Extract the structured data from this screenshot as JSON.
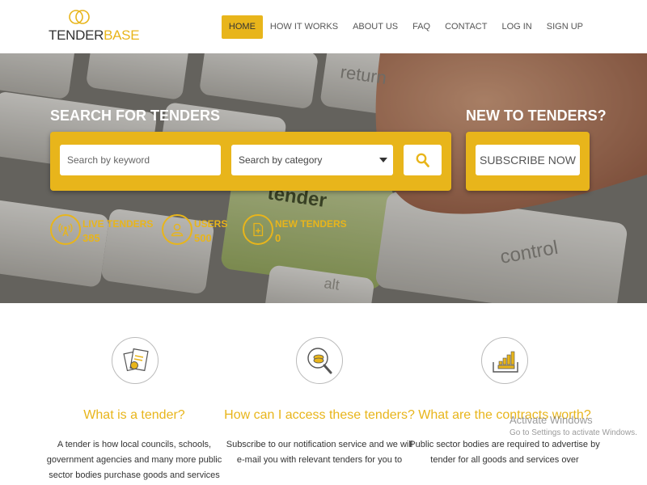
{
  "brand": {
    "logo_prefix": "TENDER",
    "logo_suffix": "BASE",
    "accent": "#e8b51b"
  },
  "nav": {
    "items": [
      {
        "label": "HOME",
        "active": true
      },
      {
        "label": "HOW IT WORKS"
      },
      {
        "label": "ABOUT US"
      },
      {
        "label": "FAQ"
      },
      {
        "label": "CONTACT"
      },
      {
        "label": "LOG IN"
      },
      {
        "label": "SIGN UP"
      }
    ]
  },
  "hero": {
    "search_title": "SEARCH FOR TENDERS",
    "keyword_placeholder": "Search by keyword",
    "category_selected": "Search by category",
    "new_title": "NEW TO TENDERS?",
    "subscribe_label": "SUBSCRIBE NOW",
    "keyboard_keys": [
      "return",
      "tender",
      "control",
      "alt"
    ]
  },
  "stats": [
    {
      "label": "LIVE TENDERS",
      "value": "385",
      "icon": "broadcast-icon"
    },
    {
      "label": "USERS",
      "value": "500",
      "icon": "user-icon"
    },
    {
      "label": "NEW TENDERS",
      "value": "0",
      "icon": "new-document-icon"
    }
  ],
  "info": [
    {
      "title": "What is a tender?",
      "body": "A tender is how local councils, schools, government agencies and many more public sector bodies purchase goods and services",
      "icon": "documents-icon"
    },
    {
      "title": "How can I access these tenders?",
      "body": "Subscribe to our notification service and we will e-mail you with relevant tenders for you to",
      "icon": "search-coins-icon"
    },
    {
      "title": "What are the contracts worth?",
      "body": "Public sector bodies are required to advertise by tender for all goods and services over",
      "icon": "coin-stack-icon"
    }
  ],
  "watermark": {
    "line1": "Activate Windows",
    "line2": "Go to Settings to activate Windows."
  }
}
